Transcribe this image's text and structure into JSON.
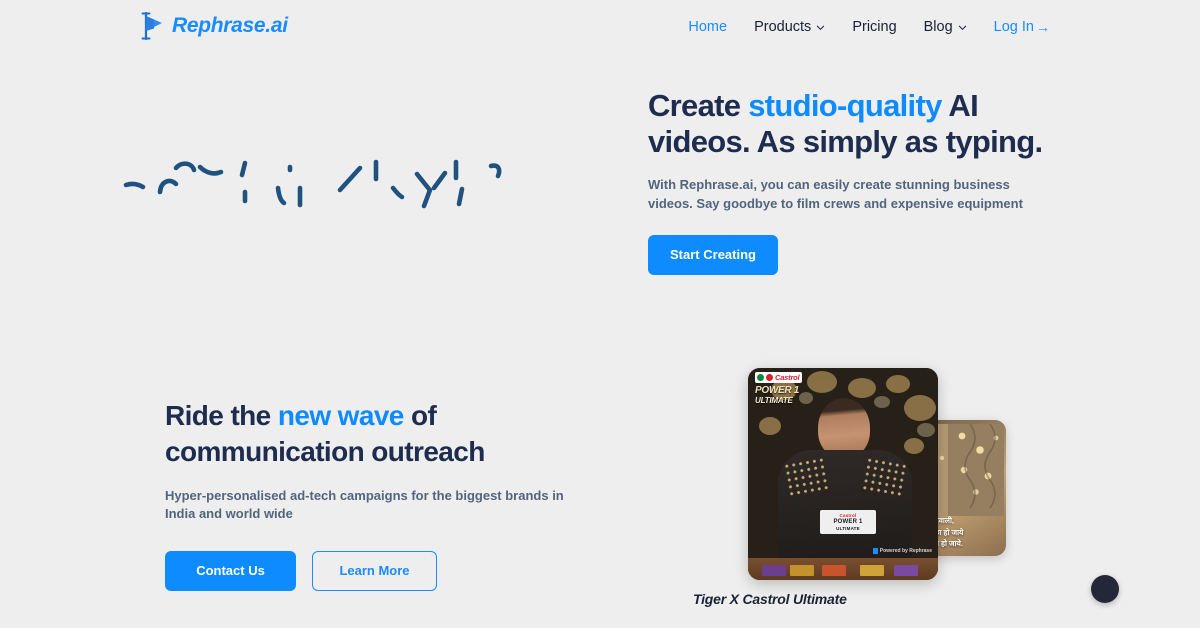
{
  "brand": {
    "name": "Rephrase.ai",
    "logo_icon": "flag-play-icon",
    "accent_blue": "#0d8bff",
    "logo_blue": "#1a8cff",
    "dark_navy": "#1e2d4f",
    "body_gray": "#52657d",
    "page_background": "#eeeeee"
  },
  "nav": {
    "items": [
      {
        "label": "Home",
        "active": true,
        "has_dropdown": false
      },
      {
        "label": "Products",
        "active": false,
        "has_dropdown": true,
        "icon": "chevron-down-icon"
      },
      {
        "label": "Pricing",
        "active": false,
        "has_dropdown": false
      },
      {
        "label": "Blog",
        "active": false,
        "has_dropdown": true,
        "icon": "chevron-down-icon"
      }
    ],
    "login": {
      "label": "Log In",
      "icon": "arrow-right-icon",
      "arrow": "→"
    }
  },
  "hero": {
    "title_part1": "Create ",
    "title_highlight": "studio-quality",
    "title_part2": " AI videos. As simply as typing.",
    "subtitle": "With Rephrase.ai, you can easily create stunning business videos. Say goodbye to film crews and expensive equipment",
    "cta_label": "Start Creating",
    "decoration": "handwriting-scribble-illustration"
  },
  "outreach": {
    "title_part1": "Ride the ",
    "title_highlight": "new wave",
    "title_part2": " of communication outreach",
    "subtitle": "Hyper-personalised ad-tech campaigns for the biggest brands in India and world wide",
    "primary_cta": "Contact Us",
    "secondary_cta": "Learn More"
  },
  "showcase": {
    "caption": "Tiger X Castrol Ultimate",
    "front_card": {
      "brand_dot_red": "Castrol",
      "brand_line1": "POWER 1",
      "brand_line2": "ULTIMATE",
      "jacket_badge_line1": "Castrol",
      "jacket_badge_line2": "POWER 1",
      "jacket_badge_line3": "ULTIMATE",
      "watermark": "Powered by Rephrase"
    },
    "back_card": {
      "caption_line1": "इस दिवाली,",
      "caption_line2": "कुछ अच्छा हो जाये",
      "caption_line3": "कुछ मीठा हो जाये."
    }
  },
  "chat_widget": {
    "icon": "chat-bubble-icon",
    "color": "#232738"
  }
}
